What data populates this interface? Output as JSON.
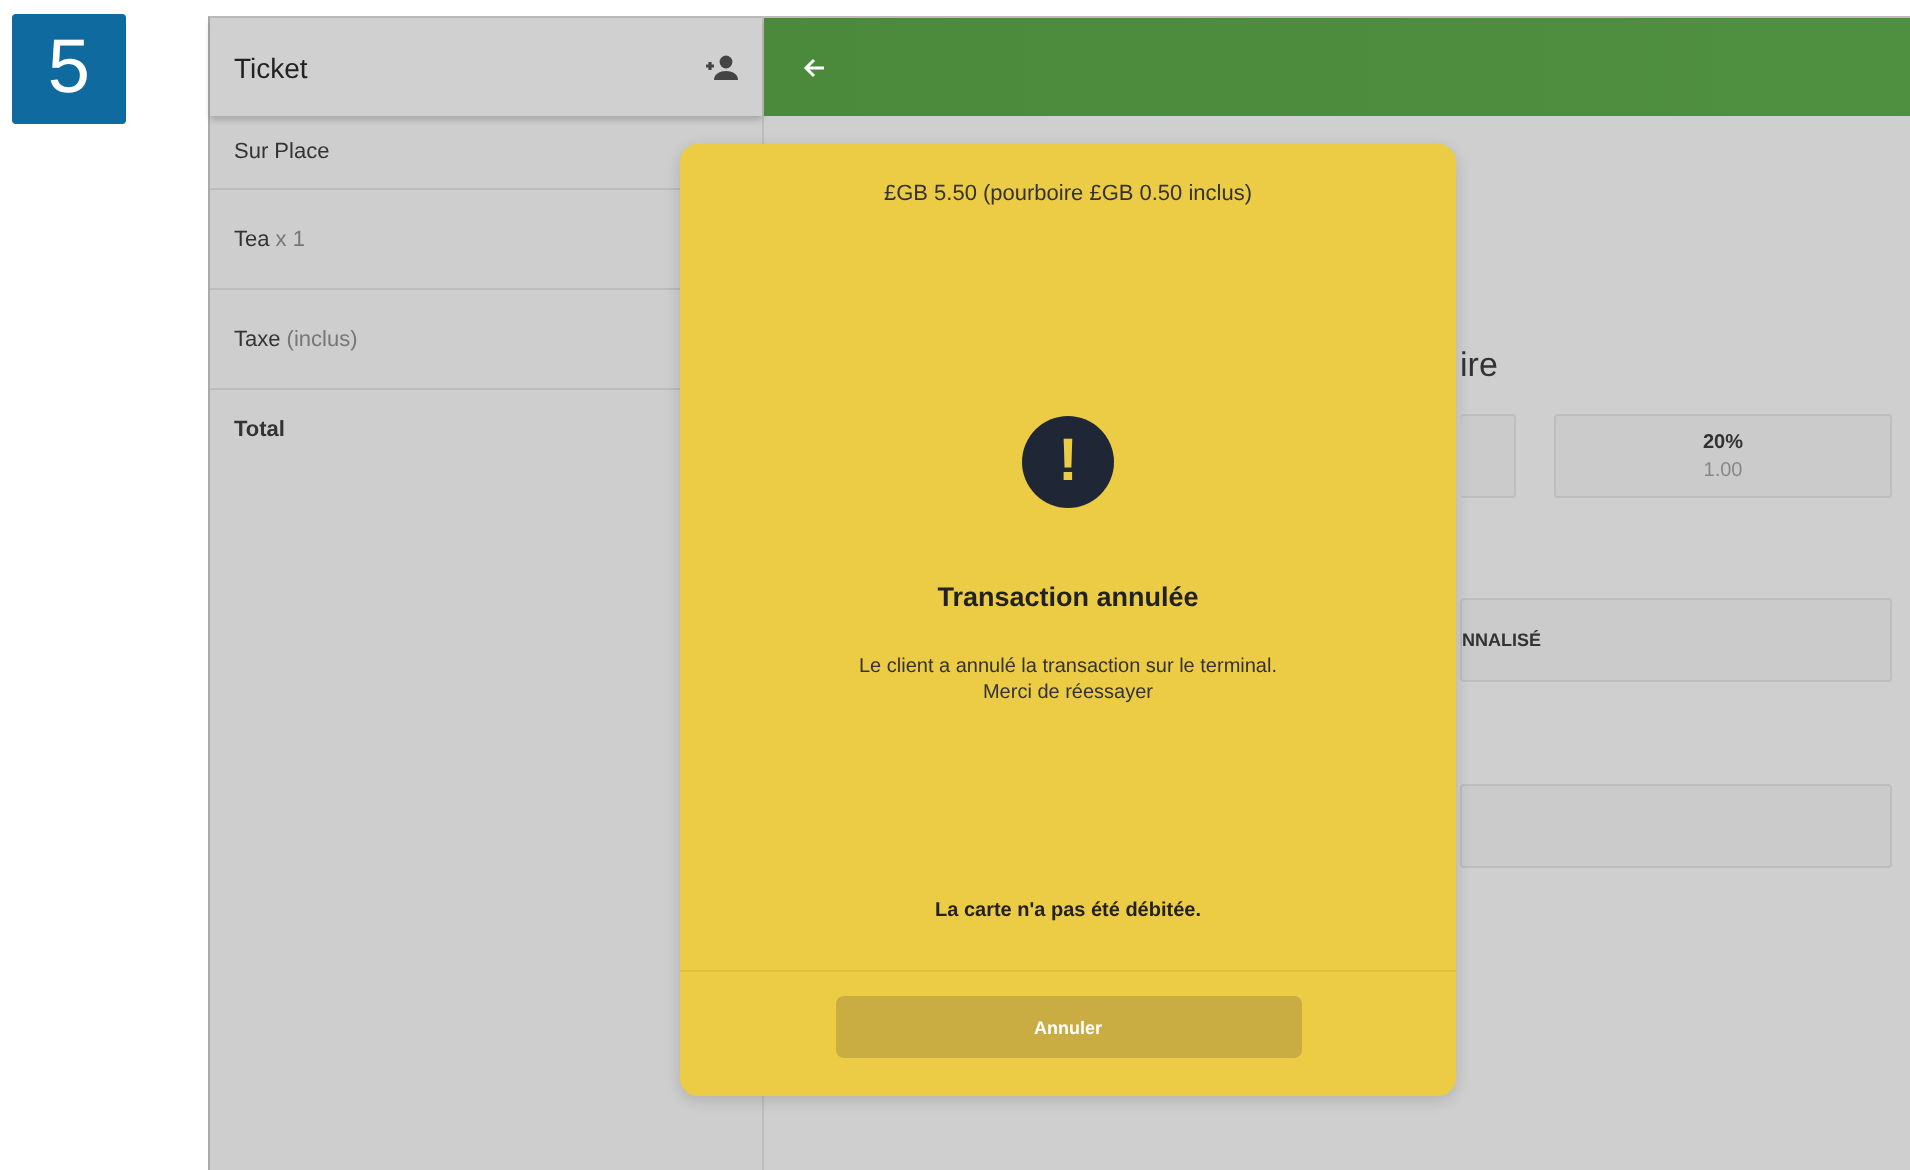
{
  "step_badge": "5",
  "ticket": {
    "title": "Ticket",
    "items": [
      {
        "kind": "section",
        "label": "Sur Place"
      },
      {
        "kind": "line",
        "label": "Tea",
        "detail": "x 1"
      },
      {
        "kind": "line",
        "label": "Taxe",
        "detail": "(inclus)"
      },
      {
        "kind": "total",
        "label": "Total"
      }
    ]
  },
  "background": {
    "heading": "ire",
    "tip_options": [
      {
        "label": "20%",
        "amount": "1.00"
      }
    ],
    "custom_button": "NNALISÉ"
  },
  "dialog": {
    "amount": "£GB 5.50 (pourboire £GB 0.50 inclus)",
    "icon_glyph": "!",
    "title": "Transaction annulée",
    "message": [
      "Le client a annulé la transaction sur le terminal.",
      "Merci de réessayer"
    ],
    "note": "La carte n'a pas été débitée.",
    "button": "Annuler"
  }
}
